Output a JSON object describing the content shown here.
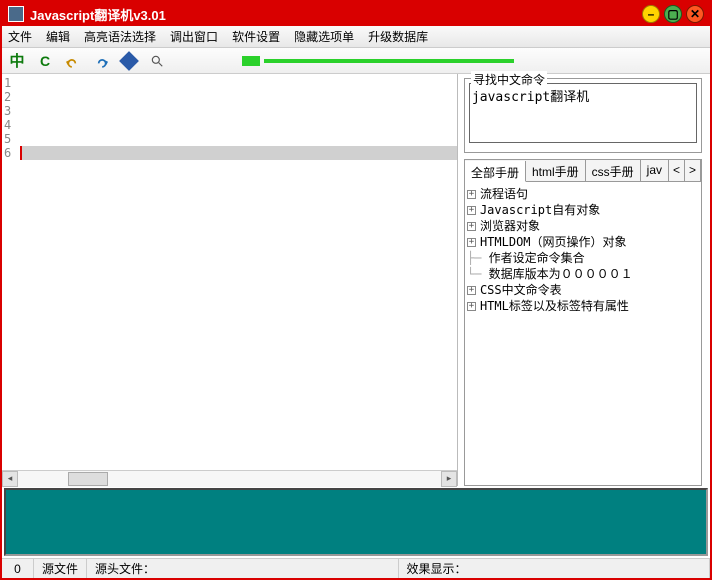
{
  "window": {
    "title": "Javascript翻译机v3.01"
  },
  "menu": {
    "file": "文件",
    "edit": "编辑",
    "syntax": "高亮语法选择",
    "popout": "调出窗口",
    "settings": "软件设置",
    "hidden": "隐藏选项单",
    "upgrade": "升级数据库"
  },
  "toolbar": {
    "cn": "中",
    "c": "C"
  },
  "editor": {
    "lines": [
      "1",
      "2",
      "3",
      "4",
      "5",
      "6"
    ]
  },
  "search": {
    "legend": "寻找中文命令",
    "value": "javascript翻译机"
  },
  "tabs": {
    "all": "全部手册",
    "html": "html手册",
    "css": "css手册",
    "js": "jav",
    "left": "<",
    "right": ">"
  },
  "tree": {
    "n0": "流程语句",
    "n1": "Javascript自有对象",
    "n2": "浏览器对象",
    "n3": "HTMLDOM（网页操作）对象",
    "n4": "作者设定命令集合",
    "n5": "数据库版本为０００００１",
    "n6": "CSS中文命令表",
    "n7": "HTML标签以及标签特有属性"
  },
  "status": {
    "zero": "0",
    "src": "源文件",
    "srchead": "源头文件：",
    "effect": "效果显示："
  }
}
